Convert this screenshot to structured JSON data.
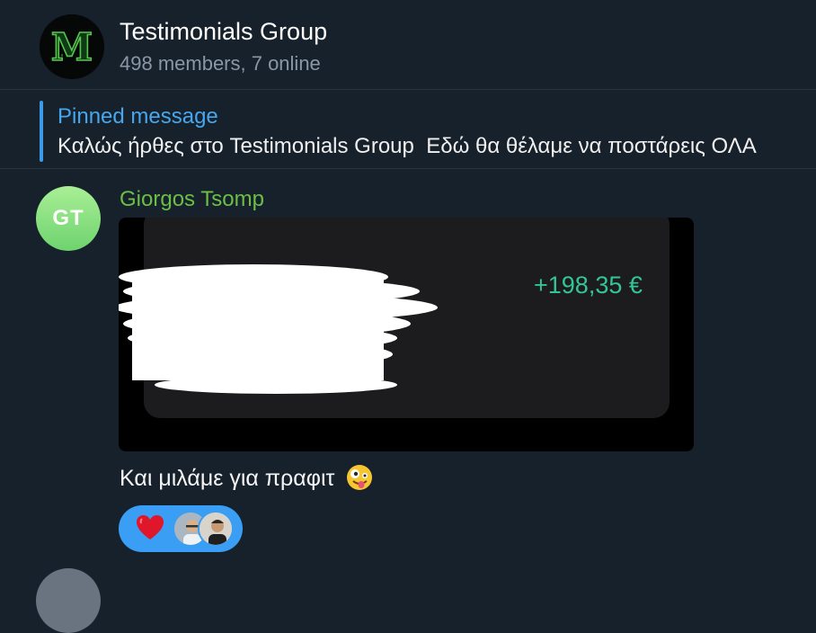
{
  "header": {
    "title": "Testimonials Group",
    "status": "498 members, 7 online",
    "avatar_letter": "M",
    "avatar_icon": "matrix-m-logo-icon"
  },
  "pinned": {
    "label": "Pinned message",
    "text": "Καλώς ήρθες στο Testimonials Group  Εδώ θα θέλαμε να ποστάρεις ΟΛΑ"
  },
  "message": {
    "avatar_initials": "GT",
    "sender": "Giorgos Tsomp",
    "image": {
      "amount": "+198,35 €",
      "redacted": true
    },
    "caption": "Και μιλάμε για πραφιτ",
    "caption_emoji": "zany-face-icon"
  },
  "reactions": [
    {
      "emoji": "red-heart-icon",
      "reactors": [
        "reactor-avatar-1",
        "reactor-avatar-2"
      ]
    }
  ],
  "colors": {
    "background": "#17212b",
    "accent": "#46a6ee",
    "sender": "#6cbe45",
    "amount": "#35c496",
    "reaction_pill": "#3a9ef4"
  }
}
